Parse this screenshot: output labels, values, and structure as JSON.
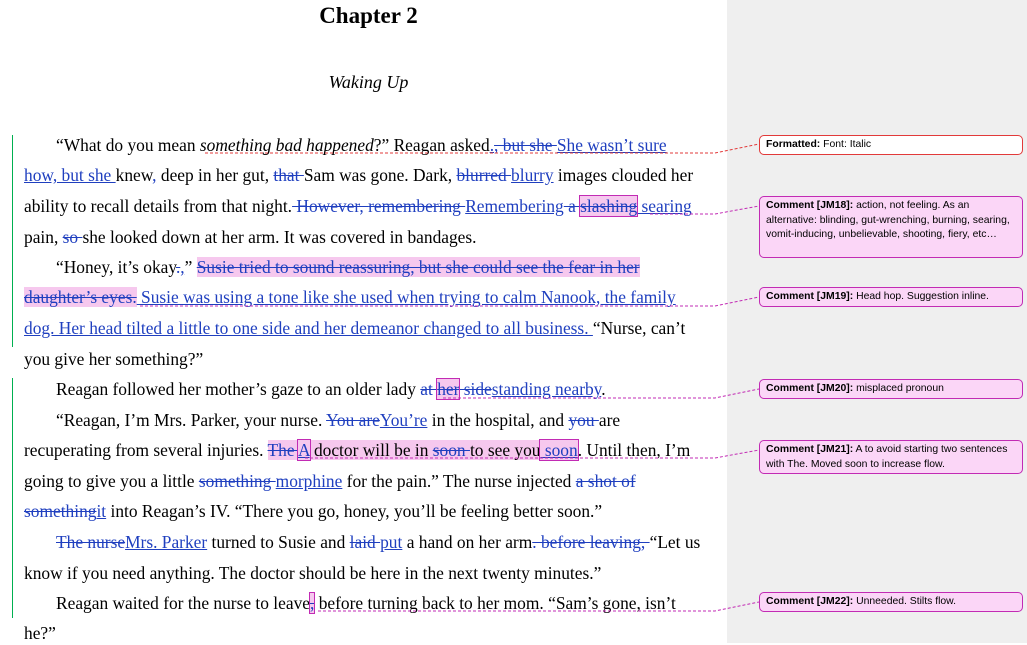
{
  "chapter": {
    "title": "Chapter 2",
    "subtitle": "Waking Up"
  },
  "lines": {
    "l1": {
      "a": "“What do you mean ",
      "b": "something bad happened",
      "c": "?” Reagan asked",
      "d": ".",
      "e": ", but she ",
      "f": "She wasn’t sure"
    },
    "l2": {
      "a": "how, but she ",
      "b": "knew",
      "c": ",",
      "d": " deep in her gut, ",
      "e": "that ",
      "f": "Sam was gone. Dark, ",
      "g": "blurred ",
      "h": "blurry",
      "i": " images clouded her"
    },
    "l3": {
      "a": "ability to recall details from that night.",
      "b": " However, ",
      "c": "remembering ",
      "d": "Remembering",
      "e": " a ",
      "f": "slashing",
      "g": " searing"
    },
    "l4": {
      "a": "pain, ",
      "b": "so ",
      "c": "she looked down at her arm. It was covered in bandages."
    },
    "l5": {
      "a": "“Honey, it’s okay",
      "b": ".",
      "c": ",",
      "d": "” ",
      "e": "Susie tried to sound reassuring, but she could see the fear in her"
    },
    "l6": {
      "a": "daughter’s eyes.",
      "b": " Susie was using a tone like she used when trying to calm Nanook, the family"
    },
    "l7": {
      "a": "dog. Her head tilted a little to one side and her demeanor changed to all business. ",
      "b": "“Nurse, can’t"
    },
    "l8": {
      "a": "you give her something?”"
    },
    "l9": {
      "a": "Reagan followed her mother’s gaze to an older lady ",
      "b": "at ",
      "c": "her",
      "d": " side",
      "e": "standing nearby",
      "f": "."
    },
    "l10": {
      "a": "“Reagan, I’m Mrs. Parker, your nurse. ",
      "b": "You are",
      "c": "You’re",
      "d": " in the hospital, and ",
      "e": "you ",
      "f": "are"
    },
    "l11": {
      "a": "recuperating from several injuries. ",
      "b": "The ",
      "c": "A",
      "d": " doctor will be in ",
      "e": "soon ",
      "f": "to see you",
      "g": " soon",
      "h": ". Until then, I’m"
    },
    "l12": {
      "a": "going to give you a little ",
      "b": "something ",
      "c": "morphine",
      "d": " for the pain.” The nurse injected ",
      "e": "a shot of"
    },
    "l13": {
      "a": "something",
      "b": "it",
      "c": " into Reagan’s IV. “There you go, honey, you’ll be feeling better soon.”"
    },
    "l14": {
      "a": "The nurse",
      "b": "Mrs. Parker",
      "c": " turned to Susie and ",
      "d": "laid ",
      "e": "put",
      "f": " a hand on her arm",
      "g": ". before leaving, ",
      "h": "“Let us"
    },
    "l15": {
      "a": "know if you need anything. The doctor should be here in the next twenty minutes.”"
    },
    "l16": {
      "a": "Reagan waited for the nurse to leave",
      "b": ",",
      "c": " before turning back to her mom. “Sam’s gone, isn’t"
    },
    "l17": {
      "a": "he?”"
    }
  },
  "comments": [
    {
      "label": "Formatted:",
      "text": " Font: Italic"
    },
    {
      "label": "Comment [JM18]:",
      "text": " action, not feeling. As an alternative: blinding, gut-wrenching, burning, searing, vomit-inducing, unbelievable, shooting, fiery, etc…"
    },
    {
      "label": "Comment [JM19]:",
      "text": " Head hop. Suggestion inline."
    },
    {
      "label": "Comment [JM20]:",
      "text": " misplaced pronoun"
    },
    {
      "label": "Comment [JM21]:",
      "text": " A to avoid starting two sentences with The. Moved soon to increase flow."
    },
    {
      "label": "Comment [JM22]:",
      "text": " Unneeded. Stilts flow."
    }
  ],
  "colors": {
    "revision": "#1f3fbf",
    "comment_border": "#c22bb4",
    "comment_fill": "#fbd6f7",
    "format_border": "#e23a3a",
    "change_bar": "#00b050"
  }
}
